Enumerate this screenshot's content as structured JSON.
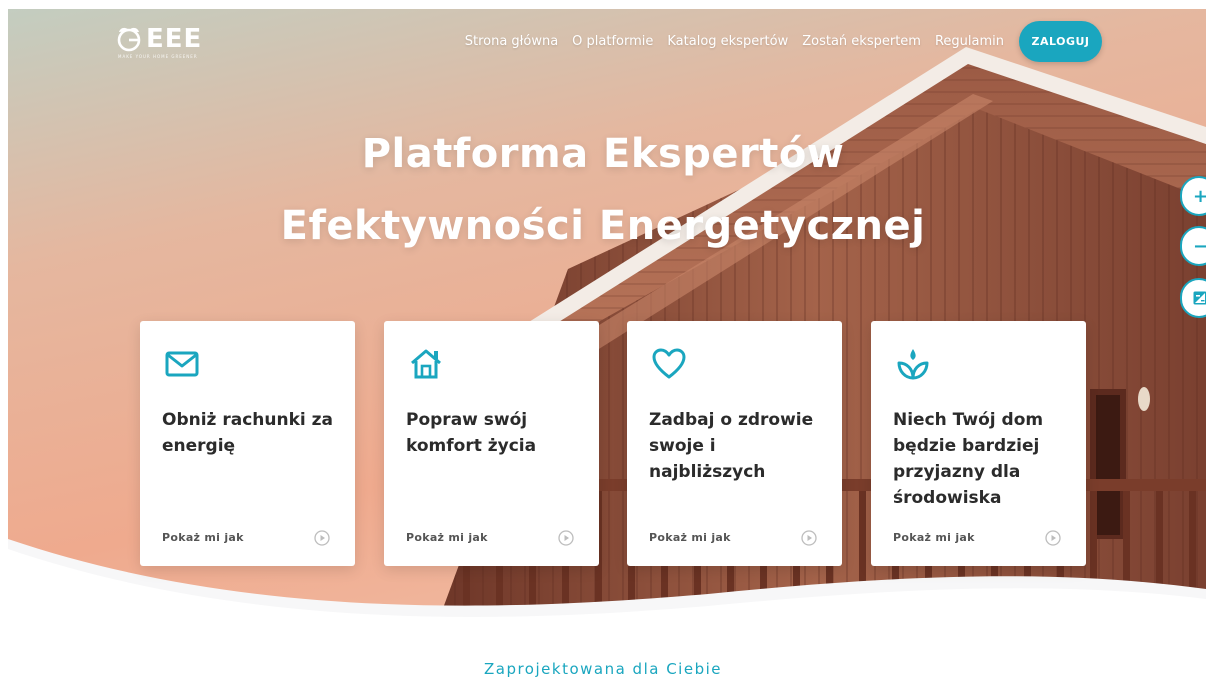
{
  "header": {
    "logo_text": "EEE",
    "logo_tagline": "MAKE YOUR HOME GREENER",
    "nav": [
      {
        "label": "Strona główna"
      },
      {
        "label": "O platformie"
      },
      {
        "label": "Katalog ekspertów"
      },
      {
        "label": "Zostań ekspertem"
      },
      {
        "label": "Regulamin"
      }
    ],
    "login_label": "ZALOGUJ"
  },
  "hero": {
    "title_line1": "Platforma Ekspertów",
    "title_line2": "Efektywności Energetycznej"
  },
  "cards": [
    {
      "icon": "envelope-icon",
      "title": "Obniż rachunki za energię",
      "link": "Pokaż mi jak"
    },
    {
      "icon": "home-icon",
      "title": "Popraw swój komfort życia",
      "link": "Pokaż mi jak"
    },
    {
      "icon": "heart-icon",
      "title": "Zadbaj o zdrowie swoje i najbliższych",
      "link": "Pokaż mi jak"
    },
    {
      "icon": "plant-icon",
      "title": "Niech Twój dom będzie bardziej przyjazny dla środowiska",
      "link": "Pokaż mi jak"
    }
  ],
  "side_tools": {
    "zoom_in": "+",
    "zoom_out": "−",
    "contrast": "contrast-icon"
  },
  "section": {
    "subtitle": "Zaprojektowana dla Ciebie"
  },
  "colors": {
    "accent": "#1aa6bf",
    "card_text": "#2b2b2b",
    "sky_top": "#b8c6ba",
    "sky_warm": "#e9a58b",
    "wood": "#8a4a35"
  }
}
